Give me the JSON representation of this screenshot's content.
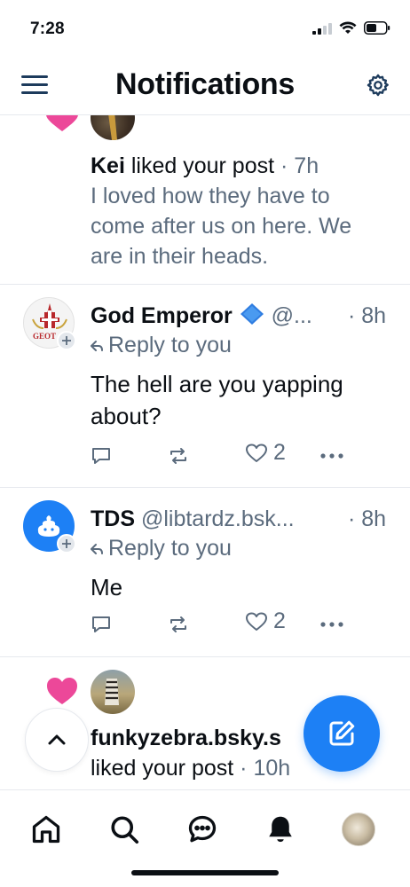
{
  "status_bar": {
    "time": "7:28"
  },
  "header": {
    "title": "Notifications"
  },
  "notifications": [
    {
      "type": "like",
      "user_name": "Kei",
      "action_text": "liked your post",
      "separator": "·",
      "time": "7h",
      "post_preview": [
        "I loved how they have to",
        "come after us on here. We",
        "are in their heads."
      ]
    },
    {
      "type": "reply",
      "user_name": "God Emperor",
      "verified_emoji": "🔷",
      "handle": "@...",
      "separator": "·",
      "time": "8h",
      "avatar_text": "GEOT",
      "reply_label": "Reply to you",
      "body": [
        "The hell are you yapping",
        "about?"
      ],
      "like_count": "2"
    },
    {
      "type": "reply",
      "user_name": "TDS",
      "handle": "@libtardz.bsk...",
      "separator": "·",
      "time": "8h",
      "reply_label": "Reply to you",
      "body": [
        "Me"
      ],
      "like_count": "2"
    },
    {
      "type": "like",
      "user_name": "funkyzebra.bsky.s",
      "action_text": "liked your post",
      "separator": "·",
      "time": "10h"
    }
  ],
  "colors": {
    "accent": "#1d80f5",
    "heart": "#ec4899",
    "muted": "#5b6b7d",
    "divider": "#e6e9ee"
  },
  "icons": {
    "menu": "hamburger-icon",
    "settings": "gear-icon",
    "heart": "heart-icon",
    "reply": "reply-arrow-icon",
    "comment": "comment-icon",
    "repost": "repost-icon",
    "like": "heart-outline-icon",
    "more": "more-icon",
    "compose": "compose-icon",
    "scroll_top": "chevron-up-icon",
    "nav": [
      "home-icon",
      "search-icon",
      "chat-icon",
      "bell-icon",
      "profile-avatar"
    ]
  }
}
